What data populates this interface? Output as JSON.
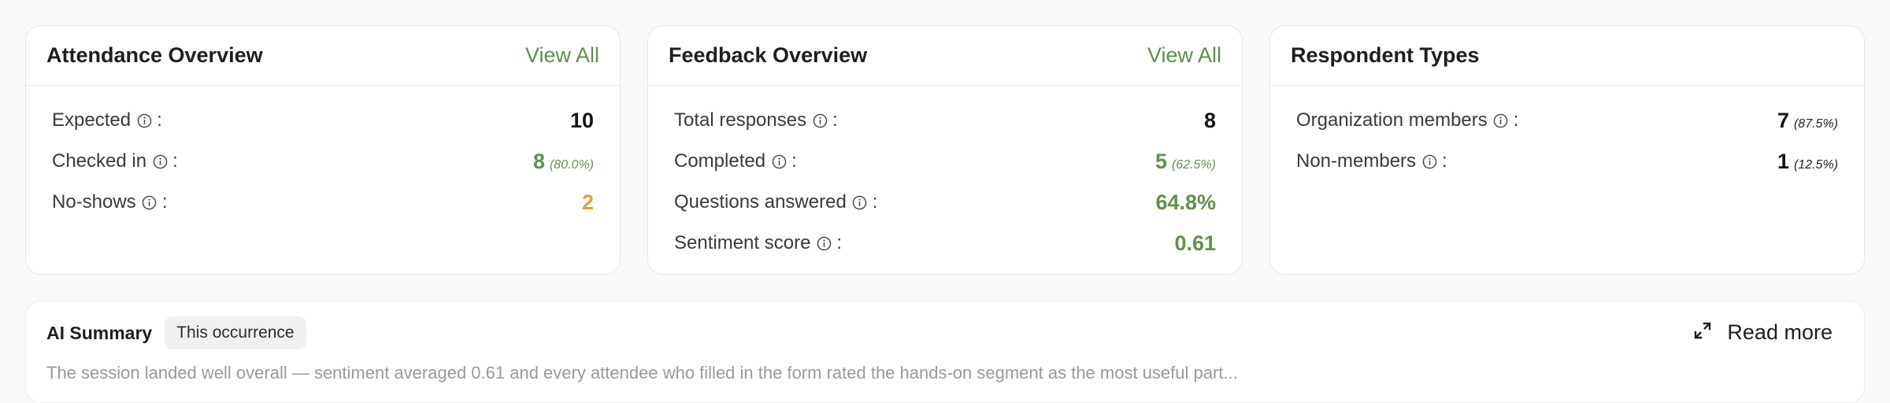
{
  "attendance": {
    "title": "Attendance Overview",
    "view_all": "View All",
    "rows": [
      {
        "label": "Expected",
        "value": "10",
        "pct": ""
      },
      {
        "label": "Checked in",
        "value": "8",
        "pct": "(80.0%)"
      },
      {
        "label": "No-shows",
        "value": "2",
        "pct": ""
      }
    ]
  },
  "feedback": {
    "title": "Feedback Overview",
    "view_all": "View All",
    "rows": [
      {
        "label": "Total responses",
        "value": "8",
        "pct": ""
      },
      {
        "label": "Completed",
        "value": "5",
        "pct": "(62.5%)"
      },
      {
        "label": "Questions answered",
        "value": "64.8%",
        "pct": ""
      },
      {
        "label": "Sentiment score",
        "value": "0.61",
        "pct": ""
      }
    ]
  },
  "respondents": {
    "title": "Respondent Types",
    "rows": [
      {
        "label": "Organization members",
        "value": "7",
        "pct": "(87.5%)"
      },
      {
        "label": "Non-members",
        "value": "1",
        "pct": "(12.5%)"
      }
    ]
  },
  "label_suffix": ":",
  "summary": {
    "title": "AI Summary",
    "chip": "This occurrence",
    "read_more": "Read more",
    "text": "The session landed well overall — sentiment averaged 0.61 and every attendee who filled in the form rated the hands-on segment as the most useful part..."
  },
  "icons": {
    "info": "info-circle-icon",
    "expand": "expand-arrows-icon"
  },
  "colors": {
    "accent_green": "#62914f",
    "warning_orange": "#e2a23b",
    "muted_text": "#9a9a98"
  }
}
